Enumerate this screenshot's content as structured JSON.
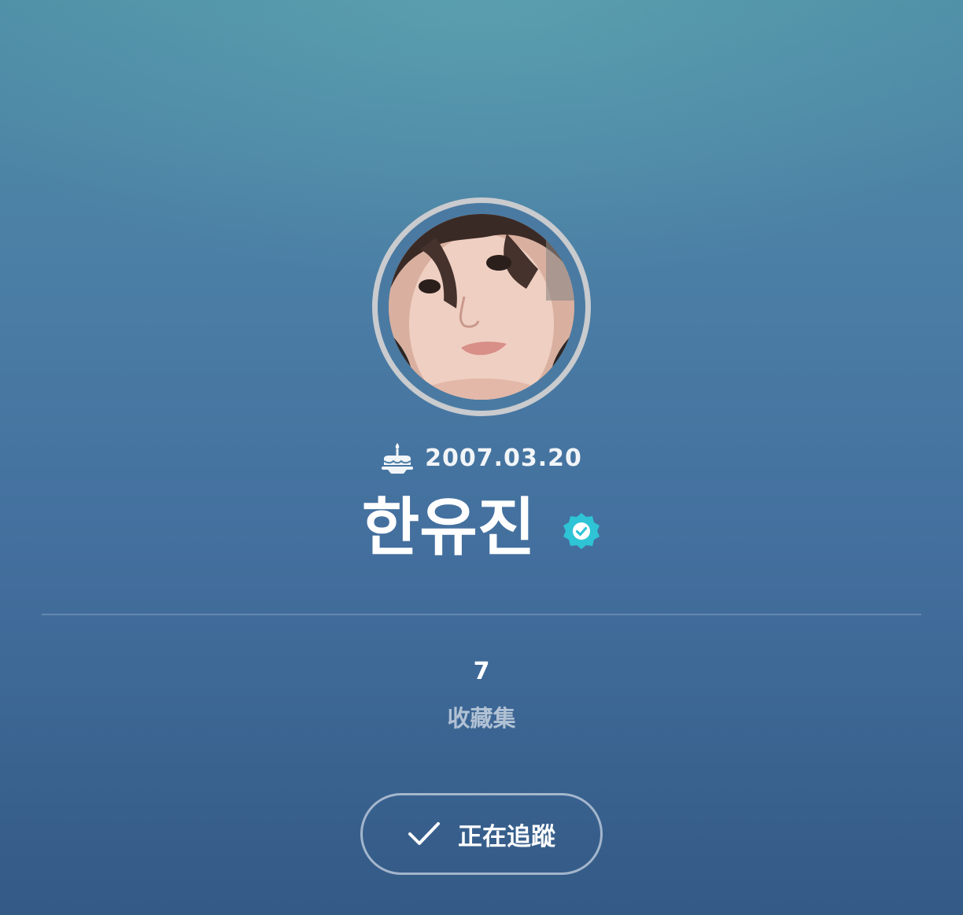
{
  "profile": {
    "birthday": "2007.03.20",
    "name": "한유진",
    "verified": true,
    "avatar_alt": "profile photo"
  },
  "stats": {
    "value": "7",
    "label": "收藏集"
  },
  "follow_button": {
    "label": "正在追蹤",
    "state": "following"
  },
  "icons": {
    "birthday": "cake-icon",
    "verified": "verified-badge-icon",
    "follow": "check-icon"
  },
  "colors": {
    "verified_badge": "#2ec4d6",
    "background_top": "#4f8ea6",
    "background_bottom": "#345a86",
    "avatar_ring": "#c9cbce"
  }
}
